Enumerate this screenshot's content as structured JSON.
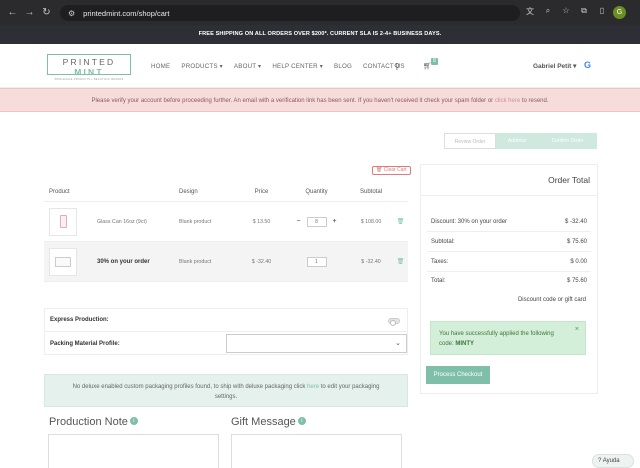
{
  "browser": {
    "url": "printedmint.com/shop/cart",
    "profile_initial": "G"
  },
  "banner": {
    "text": "FREE SHIPPING ON ALL ORDERS OVER $200*. CURRENT SLA IS 2-4+ BUSINESS DAYS."
  },
  "header": {
    "logo_word_1": "PRINTED",
    "logo_word_2": "MINT",
    "logo_tagline": "WHOLESALE PRODUCTS + BEAUTIFUL BRANDS",
    "nav": [
      "HOME",
      "PRODUCTS ▾",
      "ABOUT ▾",
      "HELP CENTER ▾",
      "BLOG",
      "CONTACT US"
    ],
    "cart_count": "8",
    "user_name": "Gabriel Petit ▾"
  },
  "alert": {
    "text": "Please verify your account before proceeding further. An email with a verification link has been sent. If you haven't received it check your spam folder or ",
    "link": "click here",
    "suffix": " to resend."
  },
  "steps": [
    "Review Order",
    "Address",
    "Confirm Order"
  ],
  "cart": {
    "clear_label": "Clear Cart",
    "headers": {
      "product": "Product",
      "design": "Design",
      "price": "Price",
      "quantity": "Quantity",
      "subtotal": "Subtotal"
    },
    "rows": [
      {
        "name": "Glass Can 16oz (9ct)",
        "design": "Blank product",
        "price": "$ 13.50",
        "quantity": "8",
        "subtotal": "$ 108.00"
      },
      {
        "name": "30% on your order",
        "design": "Blank product",
        "price": "$ -32.40",
        "quantity": "1",
        "subtotal": "$ -32.40"
      }
    ]
  },
  "options": {
    "express_label": "Express Production:",
    "packing_label": "Packing Material Profile:"
  },
  "info": {
    "line1_pre": "No deluxe enabled custom packaging profiles found, to ship with deluxe packaging click ",
    "link": "here",
    "line1_post": " to edit your packaging",
    "line2": "settings."
  },
  "notes": {
    "production_title": "Production Note",
    "gift_title": "Gift Message"
  },
  "order_total": {
    "title": "Order Total",
    "rows": [
      {
        "label": "Discount: 30% on your order",
        "value": "$ -32.40"
      },
      {
        "label": "Subtotal:",
        "value": "$ 75.60"
      },
      {
        "label": "Taxes:",
        "value": "$ 0.00"
      },
      {
        "label": "Total:",
        "value": "$ 75.60"
      }
    ],
    "discount_link": "Discount code or gift card",
    "success_pre": "You have successfully applied the following",
    "success_code_label": "code: ",
    "success_code": "MINTY",
    "checkout_label": "Process Checkout"
  },
  "help": {
    "label": "Ayuda"
  },
  "colors": {
    "brand_mint": "#7fbfa9",
    "alert_bg": "#f7dcdc",
    "banner_bg": "#2e2f36"
  }
}
